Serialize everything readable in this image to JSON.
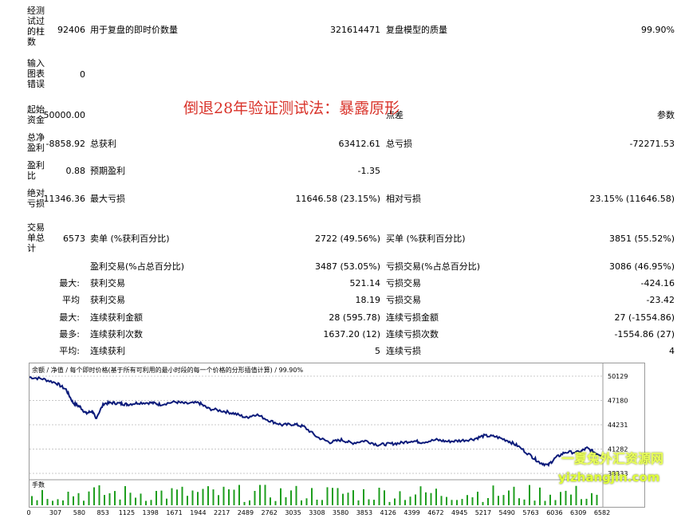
{
  "rows": {
    "bars": {
      "label": "经测试过的柱数",
      "value": "92406",
      "l2": "用于复盘的即时价数量",
      "v2": "321614471",
      "l3": "复盘模型的质量",
      "v3": "99.90%"
    },
    "errors": {
      "label": "输入图表错误",
      "value": "0"
    },
    "deposit": {
      "label": "起始资金",
      "value": "50000.00",
      "l3": "点差",
      "v3": "参数"
    },
    "net": {
      "label": "总净盈利",
      "value": "-8858.92",
      "l2": "总获利",
      "v2": "63412.61",
      "l3": "总亏损",
      "v3": "-72271.53"
    },
    "pf": {
      "label": "盈利比",
      "value": "0.88",
      "l2": "预期盈利",
      "v2": "-1.35"
    },
    "dd": {
      "label": "绝对亏损",
      "value": "11346.36",
      "l2": "最大亏损",
      "v2": "11646.58 (23.15%)",
      "l3": "相对亏损",
      "v3": "23.15% (11646.58)"
    },
    "trades": {
      "label": "交易单总计",
      "value": "6573",
      "l2": "卖单 (%获利百分比)",
      "v2": "2722 (49.56%)",
      "l3": "买单 (%获利百分比)",
      "v3": "3851 (55.52%)"
    },
    "profitable": {
      "l2": "盈利交易(%占总百分比)",
      "v2": "3487 (53.05%)",
      "l3": "亏损交易(%占总百分比)",
      "v3": "3086 (46.95%)"
    },
    "largest": {
      "label": "最大:",
      "l2": "获利交易",
      "v2": "521.14",
      "l3": "亏损交易",
      "v3": "-424.16"
    },
    "average": {
      "label": "平均",
      "l2": "获利交易",
      "v2": "18.19",
      "l3": "亏损交易",
      "v3": "-23.42"
    },
    "maxcons": {
      "label": "最大:",
      "l2": "连续获利金额",
      "v2": "28 (595.78)",
      "l3": "连续亏损金额",
      "v3": "27 (-1554.86)"
    },
    "maxcons2": {
      "label": "最多:",
      "l2": "连续获利次数",
      "v2": "1637.20 (12)",
      "l3": "连续亏损次数",
      "v3": "-1554.86 (27)"
    },
    "avgcons": {
      "label": "平均:",
      "l2": "连续获利",
      "v2": "5",
      "l3": "连续亏损",
      "v3": "4"
    }
  },
  "overlay_title": "倒退28年验证测试法：暴露原形",
  "chart_header": "余额 / 净值 / 每个即时价格(基于所有可利用的最小时段的每一个价格的分形插值计算) / 99.90%",
  "volume_label": "手数",
  "watermark": {
    "line1": "一夏兔外汇资源网",
    "line2": "yizhangjin.com"
  },
  "colors": {
    "balance": "#0a1a7a",
    "volume": "#1e9e1e",
    "grid": "#c8c8c8"
  },
  "chart_data": {
    "type": "line",
    "x_ticks": [
      0,
      307,
      580,
      853,
      1125,
      1398,
      1671,
      1944,
      2217,
      2489,
      2762,
      3035,
      3308,
      3580,
      3853,
      4126,
      4399,
      4672,
      4945,
      5217,
      5490,
      5763,
      6036,
      6309,
      6582
    ],
    "y_ticks": [
      50129,
      47180,
      44231,
      41282,
      38333
    ],
    "ylim": [
      38333,
      50129
    ],
    "xlim": [
      0,
      6582
    ],
    "series": [
      {
        "x": [
          0,
          150,
          307,
          420,
          500,
          580,
          650,
          720,
          760,
          853,
          950,
          1050,
          1125,
          1250,
          1398,
          1500,
          1671,
          1800,
          1944,
          2050,
          2217,
          2350,
          2489,
          2600,
          2762,
          2900,
          3035,
          3150,
          3308,
          3450,
          3580,
          3700,
          3853,
          4000,
          4126,
          4250,
          4399,
          4500,
          4672,
          4800,
          4945,
          5100,
          5217,
          5350,
          5490,
          5600,
          5763,
          5850,
          5950,
          6036,
          6150,
          6309,
          6400,
          6500,
          6582
        ],
        "y": [
          50000,
          49800,
          49300,
          48500,
          46900,
          46400,
          45600,
          45900,
          45000,
          46800,
          46900,
          46800,
          46700,
          46900,
          46900,
          46700,
          47000,
          46800,
          46900,
          46200,
          45900,
          45600,
          45100,
          45500,
          44700,
          44200,
          44300,
          44000,
          42700,
          42100,
          42400,
          42000,
          42300,
          41800,
          41900,
          42000,
          42300,
          42100,
          42400,
          42200,
          42300,
          42500,
          42900,
          42800,
          42300,
          41700,
          40400,
          39700,
          39300,
          40200,
          40900,
          40900,
          41400,
          40800,
          40500
        ]
      }
    ],
    "volume_x_count": 110
  }
}
